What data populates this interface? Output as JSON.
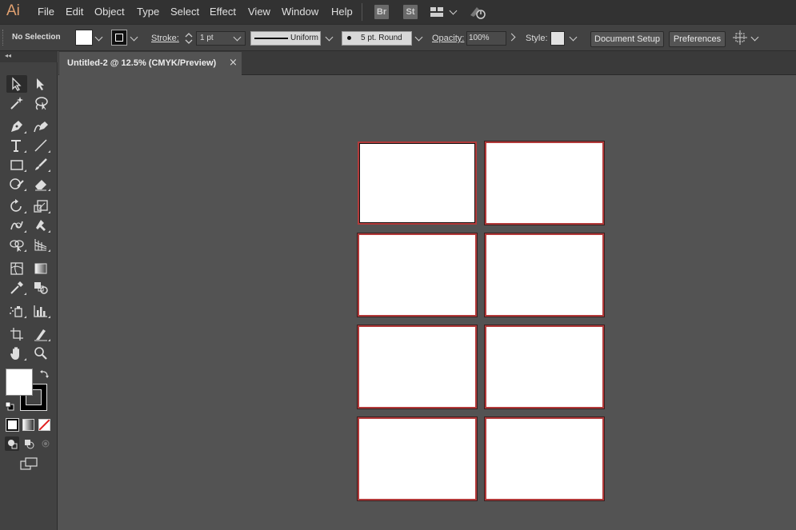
{
  "app": {
    "logo": "Ai"
  },
  "menubar": {
    "items": [
      "File",
      "Edit",
      "Object",
      "Type",
      "Select",
      "Effect",
      "View",
      "Window",
      "Help"
    ],
    "bridge_label": "Br",
    "stock_label": "St"
  },
  "controlbar": {
    "selection_status": "No Selection",
    "stroke_label": "Stroke:",
    "stroke_weight": "1 pt",
    "stroke_profile": "Uniform",
    "brush": "5 pt. Round",
    "opacity_label": "Opacity:",
    "opacity_value": "100%",
    "style_label": "Style:",
    "document_setup": "Document Setup",
    "preferences": "Preferences"
  },
  "document": {
    "tab_title": "Untitled-2 @ 12.5% (CMYK/Preview)",
    "close_glyph": "×"
  },
  "artboards": {
    "rows": 4,
    "columns": 2,
    "count": 8,
    "active_index": 0,
    "stroke_color": "#b23a3a",
    "fill_color": "#ffffff"
  },
  "tools_panel": {
    "collapse_glyph": "◂◂",
    "fill_color": "#ffffff",
    "stroke_color": "#000000"
  },
  "colors": {
    "menubar_bg": "#323232",
    "panel_bg": "#424242",
    "canvas_bg": "#535353",
    "logo_color": "#e0a070"
  }
}
